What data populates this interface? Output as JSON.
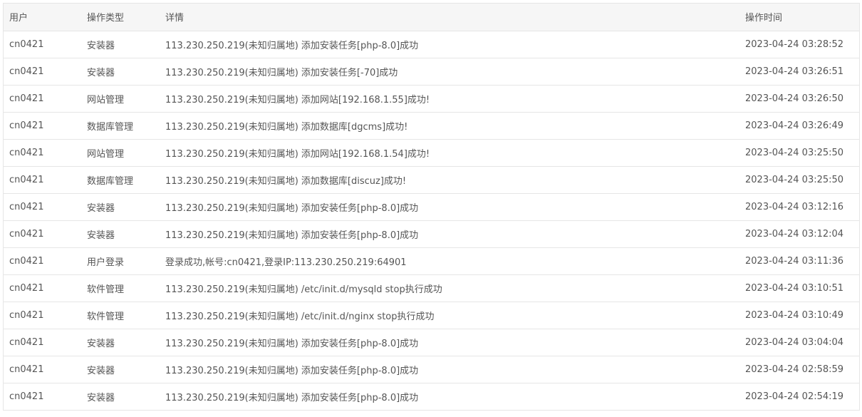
{
  "table": {
    "headers": {
      "user": "用户",
      "type": "操作类型",
      "detail": "详情",
      "time": "操作时间"
    },
    "rows": [
      {
        "user": "cn0421",
        "type": "安装器",
        "detail": "113.230.250.219(未知归属地) 添加安装任务[php-8.0]成功",
        "time": "2023-04-24 03:28:52"
      },
      {
        "user": "cn0421",
        "type": "安装器",
        "detail": "113.230.250.219(未知归属地) 添加安装任务[-70]成功",
        "time": "2023-04-24 03:26:51"
      },
      {
        "user": "cn0421",
        "type": "网站管理",
        "detail": "113.230.250.219(未知归属地) 添加网站[192.168.1.55]成功!",
        "time": "2023-04-24 03:26:50"
      },
      {
        "user": "cn0421",
        "type": "数据库管理",
        "detail": "113.230.250.219(未知归属地) 添加数据库[dgcms]成功!",
        "time": "2023-04-24 03:26:49"
      },
      {
        "user": "cn0421",
        "type": "网站管理",
        "detail": "113.230.250.219(未知归属地) 添加网站[192.168.1.54]成功!",
        "time": "2023-04-24 03:25:50"
      },
      {
        "user": "cn0421",
        "type": "数据库管理",
        "detail": "113.230.250.219(未知归属地) 添加数据库[discuz]成功!",
        "time": "2023-04-24 03:25:50"
      },
      {
        "user": "cn0421",
        "type": "安装器",
        "detail": "113.230.250.219(未知归属地) 添加安装任务[php-8.0]成功",
        "time": "2023-04-24 03:12:16"
      },
      {
        "user": "cn0421",
        "type": "安装器",
        "detail": "113.230.250.219(未知归属地) 添加安装任务[php-8.0]成功",
        "time": "2023-04-24 03:12:04"
      },
      {
        "user": "cn0421",
        "type": "用户登录",
        "detail": "登录成功,帐号:cn0421,登录IP:113.230.250.219:64901",
        "time": "2023-04-24 03:11:36"
      },
      {
        "user": "cn0421",
        "type": "软件管理",
        "detail": "113.230.250.219(未知归属地) /etc/init.d/mysqld stop执行成功",
        "time": "2023-04-24 03:10:51"
      },
      {
        "user": "cn0421",
        "type": "软件管理",
        "detail": "113.230.250.219(未知归属地) /etc/init.d/nginx stop执行成功",
        "time": "2023-04-24 03:10:49"
      },
      {
        "user": "cn0421",
        "type": "安装器",
        "detail": "113.230.250.219(未知归属地) 添加安装任务[php-8.0]成功",
        "time": "2023-04-24 03:04:04"
      },
      {
        "user": "cn0421",
        "type": "安装器",
        "detail": "113.230.250.219(未知归属地) 添加安装任务[php-8.0]成功",
        "time": "2023-04-24 02:58:59"
      },
      {
        "user": "cn0421",
        "type": "安装器",
        "detail": "113.230.250.219(未知归属地) 添加安装任务[php-8.0]成功",
        "time": "2023-04-24 02:54:19"
      }
    ]
  }
}
